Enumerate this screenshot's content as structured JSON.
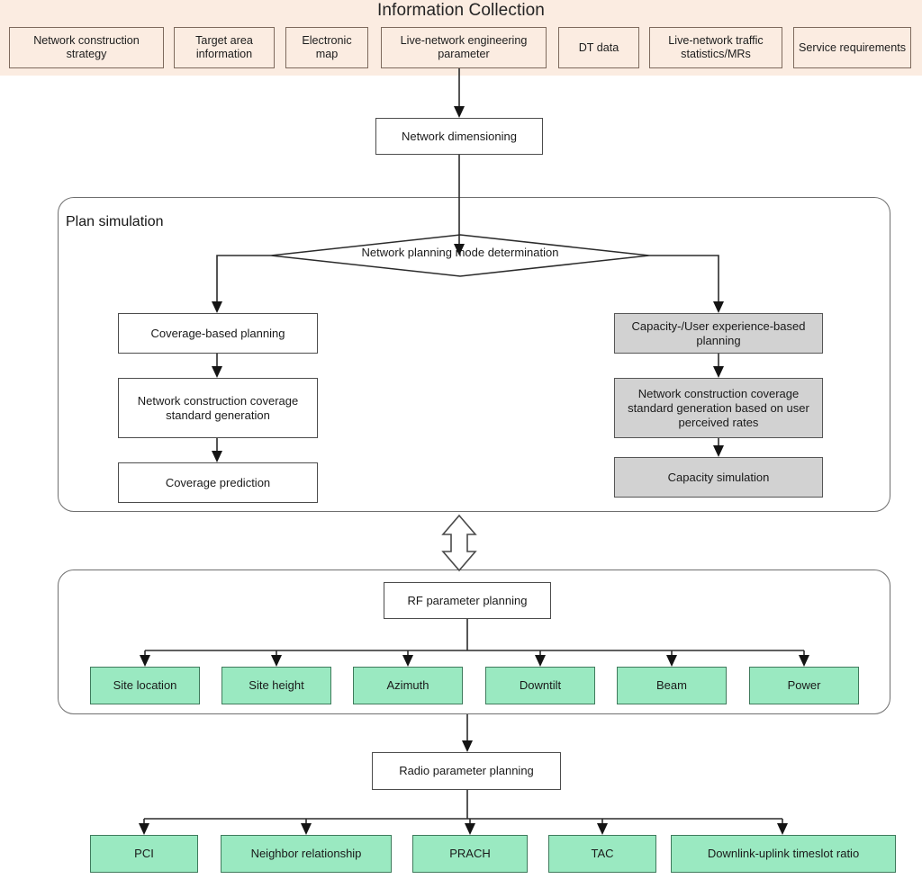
{
  "banner": {
    "title": "Information Collection",
    "bg_color": "#fbece1",
    "border_color": "#7e6a5d",
    "sources": [
      {
        "label": "Network construction strategy"
      },
      {
        "label": "Target area information"
      },
      {
        "label": "Electronic map"
      },
      {
        "label": "Live-network engineering parameter"
      },
      {
        "label": "DT data"
      },
      {
        "label": "Live-network traffic statistics/MRs"
      },
      {
        "label": "Service requirements"
      }
    ]
  },
  "dimensioning": {
    "label": "Network dimensioning"
  },
  "plan_simulation": {
    "group_label": "Plan simulation",
    "decision": "Network planning mode determination",
    "left_branch": [
      {
        "label": "Coverage-based planning",
        "fill": "white"
      },
      {
        "label": "Network construction coverage standard generation",
        "fill": "white"
      },
      {
        "label": "Coverage prediction",
        "fill": "white"
      }
    ],
    "right_branch": [
      {
        "label": "Capacity-/User experience-based planning",
        "fill": "gray"
      },
      {
        "label": "Network construction coverage standard generation based on user perceived rates",
        "fill": "gray"
      },
      {
        "label": "Capacity simulation",
        "fill": "gray"
      }
    ],
    "gray_color": "#d2d2d2"
  },
  "rf_planning": {
    "title": "RF parameter planning",
    "items": [
      {
        "label": "Site location"
      },
      {
        "label": "Site height"
      },
      {
        "label": "Azimuth"
      },
      {
        "label": "Downtilt"
      },
      {
        "label": "Beam"
      },
      {
        "label": "Power"
      }
    ],
    "green_color": "#9ae9c1"
  },
  "radio_planning": {
    "title": "Radio parameter planning",
    "items": [
      {
        "label": "PCI"
      },
      {
        "label": "Neighbor relationship"
      },
      {
        "label": "PRACH"
      },
      {
        "label": "TAC"
      },
      {
        "label": "Downlink-uplink timeslot ratio"
      }
    ],
    "green_color": "#9ae9c1"
  },
  "connector": {
    "bidirectional_arrow": "double-headed-vertical-arrow"
  }
}
